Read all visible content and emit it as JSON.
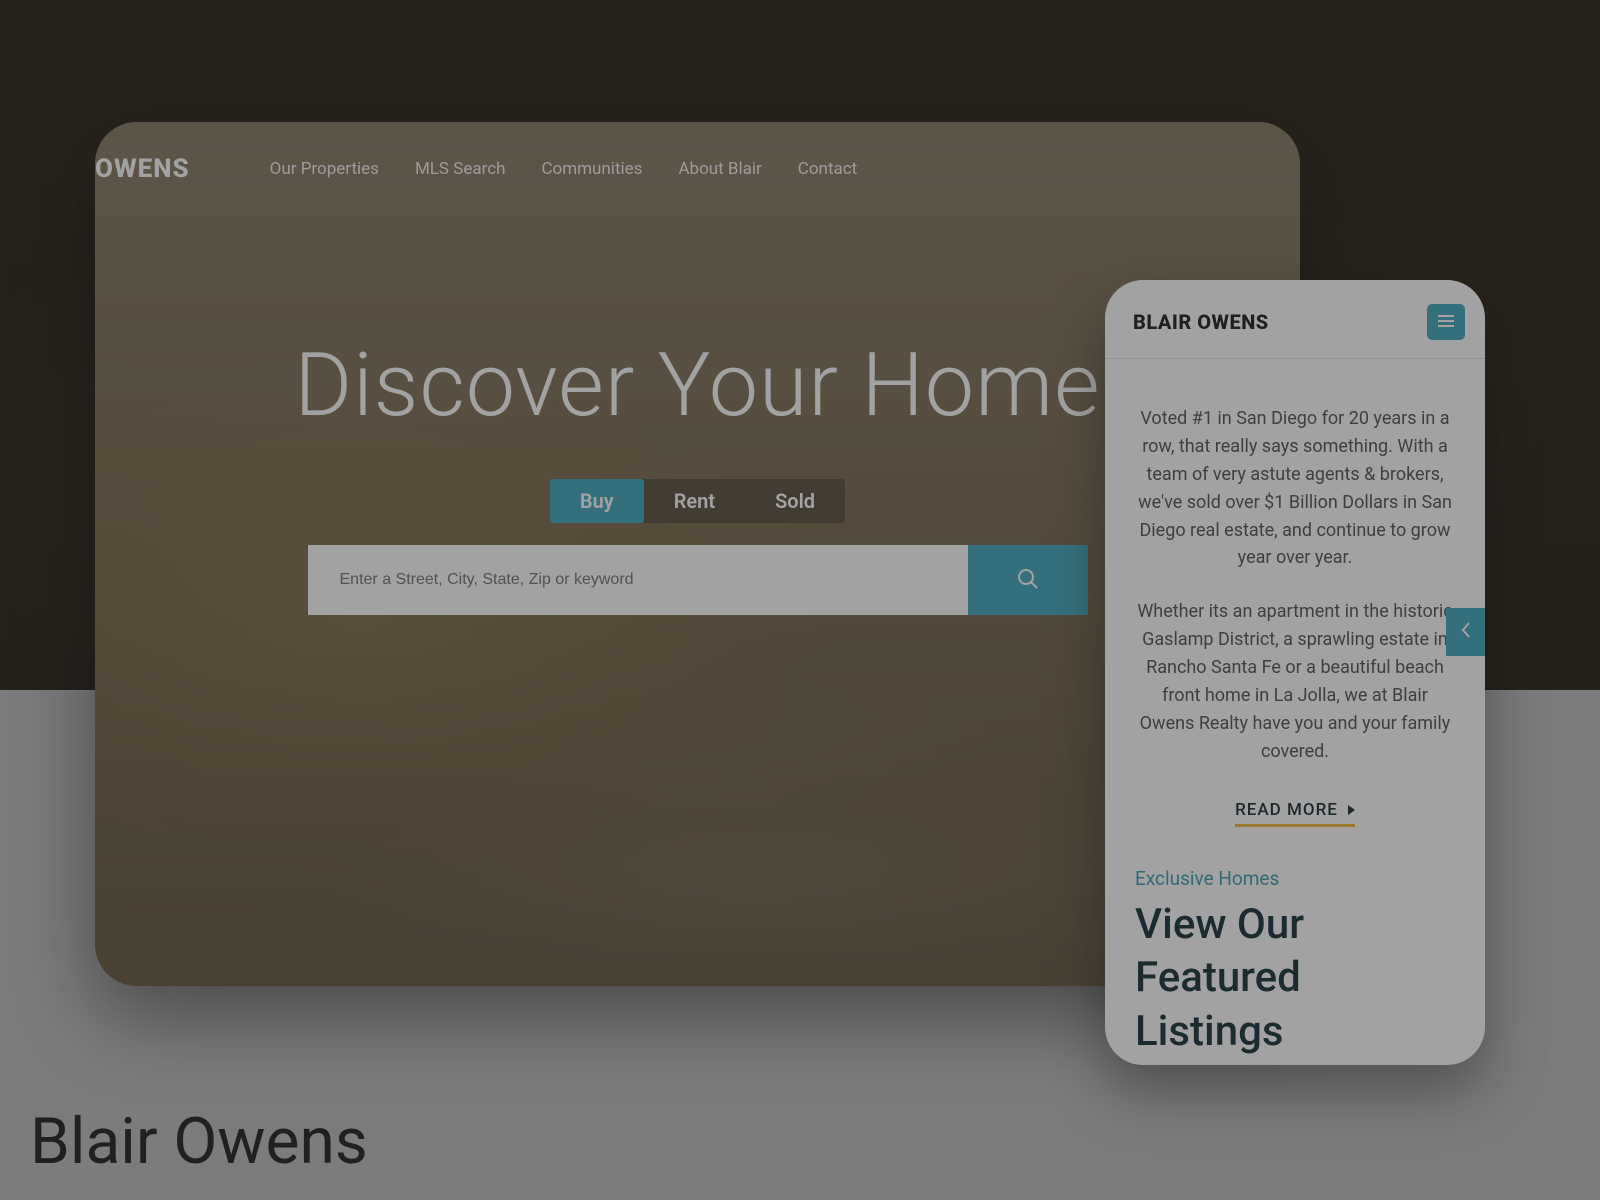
{
  "desktop": {
    "logo": "OWENS",
    "nav": [
      "Our Properties",
      "MLS Search",
      "Communities",
      "About Blair",
      "Contact"
    ],
    "hero_title": "Discover Your Home",
    "tabs": {
      "buy": "Buy",
      "rent": "Rent",
      "sold": "Sold"
    },
    "search_placeholder": "Enter a Street, City, State, Zip or keyword"
  },
  "mobile": {
    "logo": "BLAIR OWENS",
    "para1": "Voted #1 in San Diego for 20 years in a row, that really says something. With a team of very astute agents & brokers, we've sold over $1 Billion Dollars in San Diego real estate, and continue to grow year over year.",
    "para2": "Whether its an apartment in the historic Gaslamp District, a sprawling estate in Rancho Santa Fe or a beautiful beach front home in La Jolla, we at Blair Owens Realty have you and your family covered.",
    "read_more": "READ MORE",
    "eyebrow": "Exclusive Homes",
    "listings_heading": "View Our Featured Listings"
  },
  "page": {
    "heading": "Blair Owens"
  },
  "colors": {
    "accent": "#42a9bd",
    "underline": "#f0b83c"
  }
}
